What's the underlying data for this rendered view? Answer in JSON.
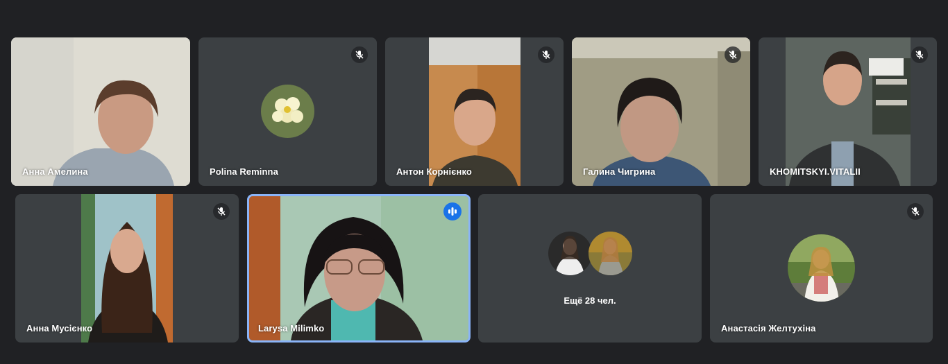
{
  "participants": [
    {
      "name": "Анна Амелина",
      "muted": false,
      "type": "video"
    },
    {
      "name": "Polina Reminna",
      "muted": true,
      "type": "avatar",
      "avatar_icon": "flower-icon"
    },
    {
      "name": "Антон Корнієнко",
      "muted": true,
      "type": "video"
    },
    {
      "name": "Галина Чигрина",
      "muted": true,
      "type": "video"
    },
    {
      "name": "KHOMITSKYI.VITALII",
      "muted": true,
      "type": "video"
    },
    {
      "name": "Анна Мусієнко",
      "muted": true,
      "type": "video"
    },
    {
      "name": "Larysa Milimko",
      "muted": false,
      "speaking": true,
      "type": "video"
    },
    {
      "name": "Анастасія Желтухіна",
      "muted": true,
      "type": "avatar"
    }
  ],
  "more_tile": {
    "label": "Ещё 28 чел.",
    "avatar_count": 2
  },
  "icons": {
    "muted": "mic-off-icon",
    "speaking": "audio-level-icon"
  },
  "colors": {
    "background": "#202124",
    "tile": "#3c4043",
    "speaking_border": "#8ab4f8",
    "speaking_badge": "#1a73e8"
  }
}
